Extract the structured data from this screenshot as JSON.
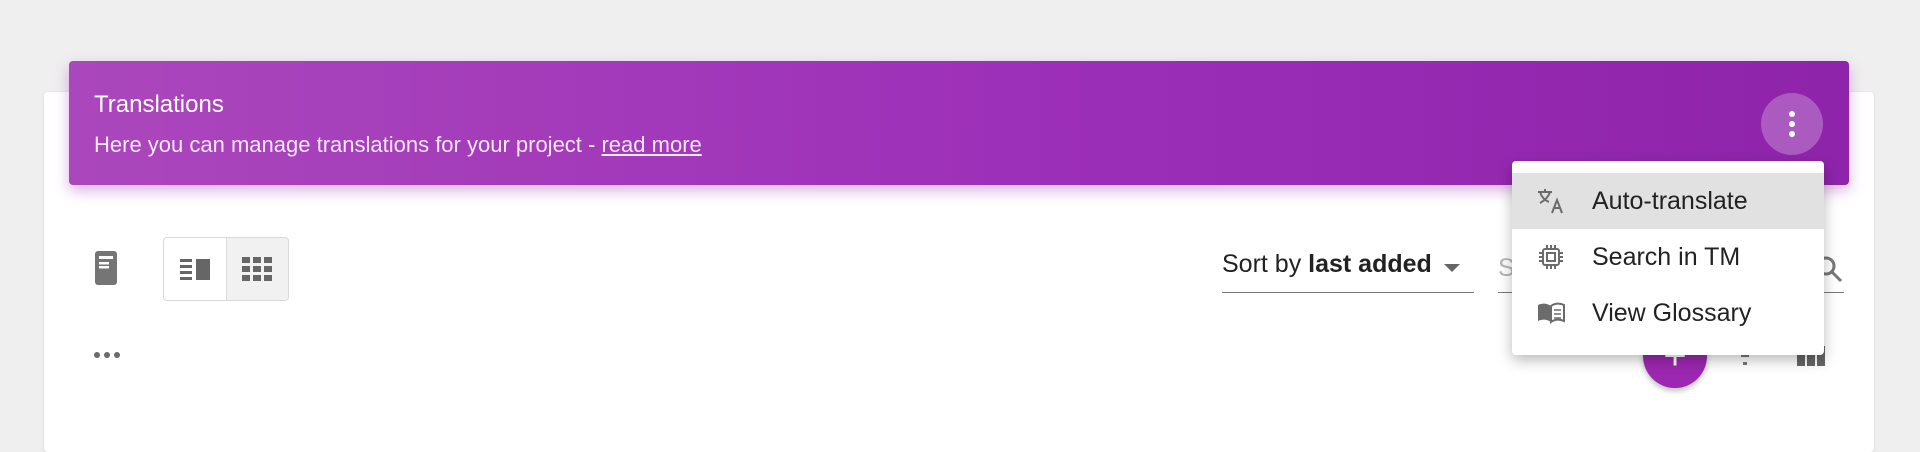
{
  "banner": {
    "title": "Translations",
    "subtitle_prefix": "Here you can manage translations for your project - ",
    "read_more": "read more",
    "gradient_colors": [
      "#ab47bc",
      "#8e24aa"
    ]
  },
  "toolbar": {
    "sort_prefix": "Sort by ",
    "sort_value": "last added",
    "search_placeholder": "Search"
  },
  "fab": {
    "label": "+",
    "color": "#9c27b0"
  },
  "menu": {
    "items": [
      {
        "label": "Auto-translate",
        "icon": "translate-icon"
      },
      {
        "label": "Search in TM",
        "icon": "memory-chip-icon"
      },
      {
        "label": "View Glossary",
        "icon": "book-icon"
      }
    ]
  }
}
